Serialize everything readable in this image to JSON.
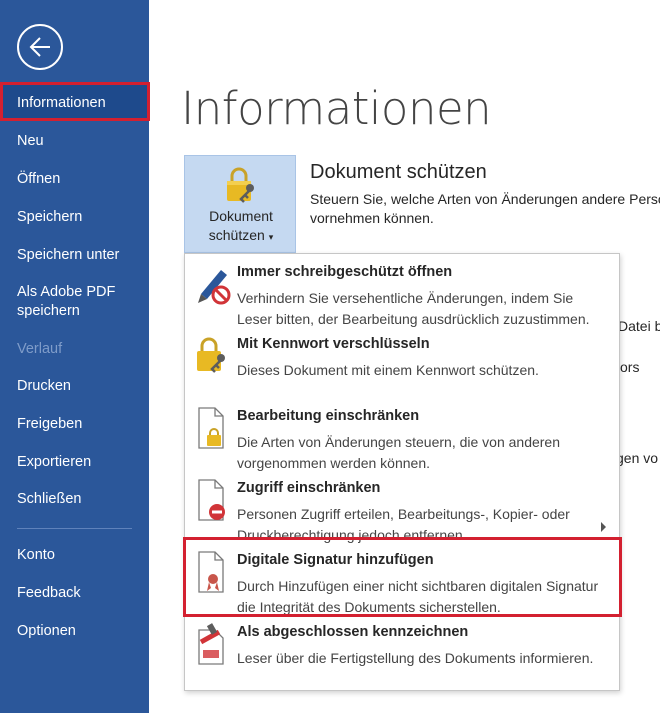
{
  "sidebar": {
    "back_icon": "arrow-left-icon",
    "items": [
      {
        "label": "Informationen",
        "state": "active"
      },
      {
        "label": "Neu"
      },
      {
        "label": "Öffnen"
      },
      {
        "label": "Speichern"
      },
      {
        "label": "Speichern unter"
      },
      {
        "label": "Als Adobe PDF speichern"
      },
      {
        "label": "Verlauf",
        "state": "disabled"
      },
      {
        "label": "Drucken"
      },
      {
        "label": "Freigeben"
      },
      {
        "label": "Exportieren"
      },
      {
        "label": "Schließen"
      },
      {
        "label": "Konto"
      },
      {
        "label": "Feedback"
      },
      {
        "label": "Optionen"
      }
    ]
  },
  "main": {
    "title": "Informationen",
    "protect_button": {
      "line1": "Dokument",
      "line2": "schützen",
      "caret": "▾"
    },
    "section": {
      "title": "Dokument schützen",
      "desc_line1": "Steuern Sie, welche Arten von Änderungen andere Perso",
      "desc_line2": "vornehmen können."
    },
    "background_fragments": [
      "Datei b",
      "ors",
      "gen vo"
    ]
  },
  "dropdown": {
    "items": [
      {
        "title": "Immer schreibgeschützt öffnen",
        "desc": "Verhindern Sie versehentliche Änderungen, indem Sie Leser bitten, der Bearbeitung ausdrücklich zuzustimmen.",
        "icon": "pen-no-entry-icon"
      },
      {
        "title": "Mit Kennwort verschlüsseln",
        "desc": "Dieses Dokument mit einem Kennwort schützen.",
        "icon": "lock-key-icon"
      },
      {
        "title": "Bearbeitung einschränken",
        "desc": "Die Arten von Änderungen steuern, die von anderen vorgenommen werden können.",
        "icon": "document-lock-icon"
      },
      {
        "title": "Zugriff einschränken",
        "desc": "Personen Zugriff erteilen, Bearbeitungs-, Kopier- oder Druckberechtigung jedoch entfernen.",
        "icon": "document-minus-icon"
      },
      {
        "title": "Digitale Signatur hinzufügen",
        "desc": "Durch Hinzufügen einer nicht sichtbaren digitalen Signatur die Integrität des Dokuments sicherstellen.",
        "icon": "document-ribbon-icon"
      },
      {
        "title": "Als abgeschlossen kennzeichnen",
        "desc": "Leser über die Fertigstellung des Dokuments informieren.",
        "icon": "document-stamp-icon"
      }
    ]
  },
  "colors": {
    "sidebar": "#2b579a",
    "highlight": "#d32030",
    "button_bg": "#c5d9f1"
  }
}
